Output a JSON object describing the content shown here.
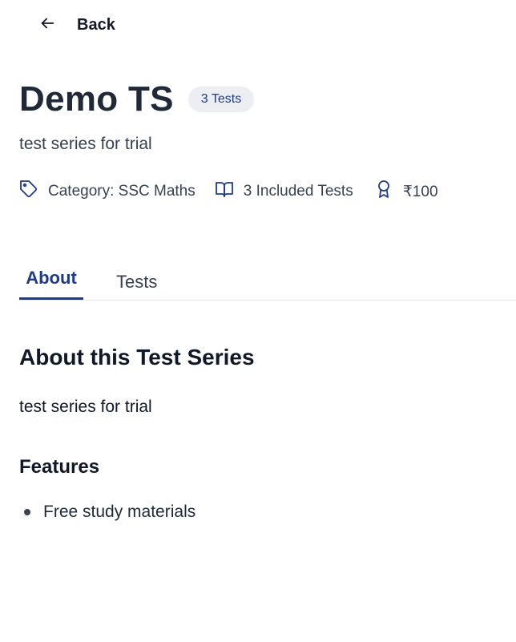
{
  "nav": {
    "back_label": "Back",
    "back_icon": "arrow-left-icon"
  },
  "header": {
    "title": "Demo TS",
    "badge": "3 Tests",
    "subtitle": "test series for trial"
  },
  "meta": {
    "category": {
      "icon": "tag-icon",
      "label": "Category: SSC Maths"
    },
    "tests": {
      "icon": "book-open-icon",
      "label": "3 Included Tests"
    },
    "price": {
      "icon": "award-icon",
      "label": "₹100"
    }
  },
  "tabs": [
    {
      "label": "About",
      "active": true
    },
    {
      "label": "Tests",
      "active": false
    }
  ],
  "about": {
    "heading": "About this Test Series",
    "description": "test series for trial",
    "features_heading": "Features",
    "features": [
      "Free study materials"
    ]
  },
  "colors": {
    "accent": "#1e3a8a",
    "text": "#1f2937",
    "badge_bg": "#eceef3",
    "divider": "#e5e7eb"
  }
}
